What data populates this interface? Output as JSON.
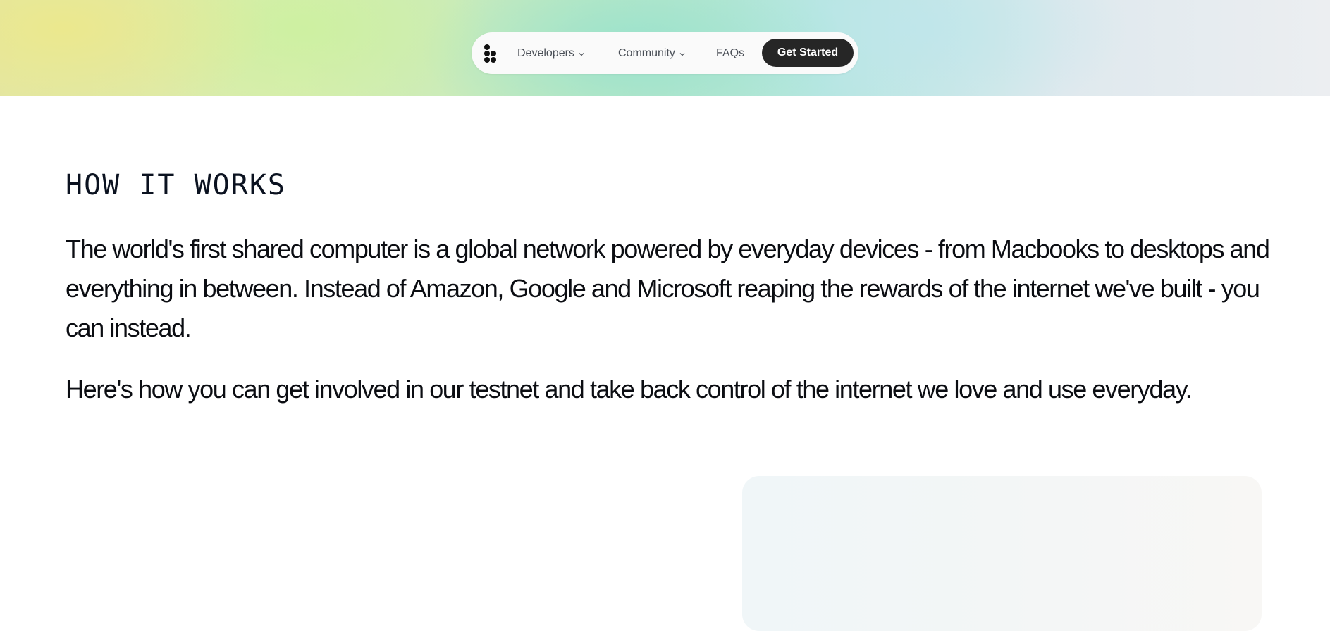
{
  "nav": {
    "logo_icon": "four-dot-logo-icon",
    "items": [
      {
        "label": "Developers",
        "has_dropdown": true
      },
      {
        "label": "Community",
        "has_dropdown": true
      },
      {
        "label": "FAQs",
        "has_dropdown": false
      }
    ],
    "cta_label": "Get Started"
  },
  "section": {
    "heading": "HOW IT WORKS",
    "paragraphs": [
      "The world's first shared computer is a global network powered by everyday devices - from Macbooks to desktops and everything in between. Instead of Amazon, Google and Microsoft reaping the rewards of the internet we've built - you can instead.",
      "Here's how you can get involved in our testnet and take back control of the internet we love and use everyday."
    ]
  },
  "colors": {
    "cta_background": "#262626",
    "text": "#0b0d12",
    "nav_text": "#4a4f57"
  }
}
